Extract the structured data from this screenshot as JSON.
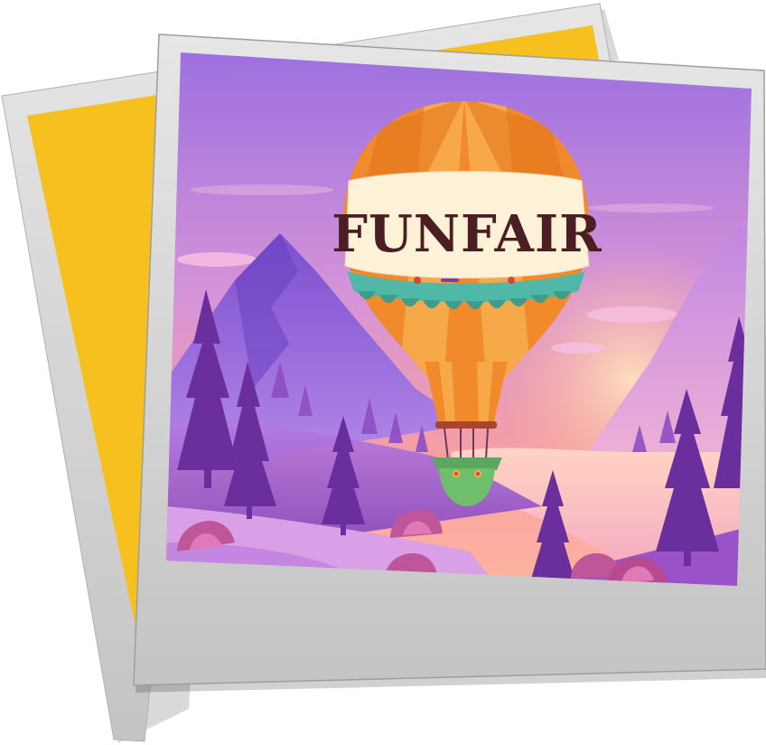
{
  "image": {
    "kind": "illustration-stacked-polaroids",
    "back_card": {
      "frame_color": "#d9d9d9",
      "fill_color": "#f6c01e"
    },
    "front_card": {
      "frame_color": "#cdcdcd"
    },
    "scene": {
      "sky_top": "#9b6fe0",
      "sky_mid": "#d694d8",
      "sky_low": "#f8a0a0",
      "sun_glow": "#ffb38f",
      "mountain": "#8a55d6",
      "tree": "#6a2f9c",
      "river": "#ffc9b8"
    },
    "balloon": {
      "banner_text": "FUNFAIR",
      "envelope_color": "#f08a2a",
      "stripe_color": "#f7a94a",
      "band_color": "#fdf1d8",
      "trim_color": "#4fb8a6",
      "basket_color": "#6ebe6b"
    }
  }
}
